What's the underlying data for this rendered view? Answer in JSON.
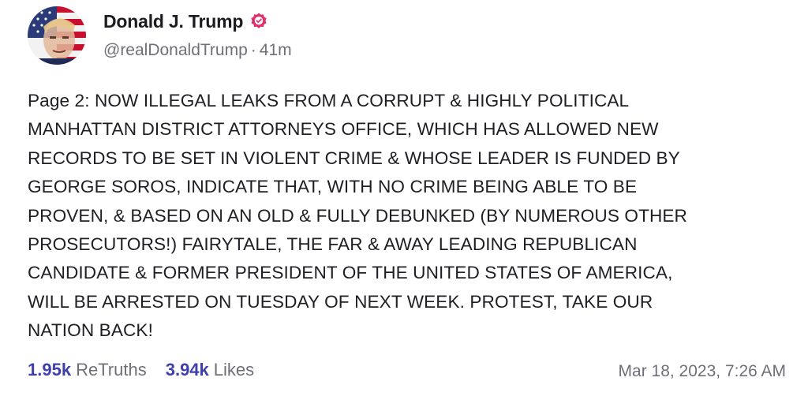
{
  "author": {
    "display_name": "Donald J. Trump",
    "handle": "@realDonaldTrump",
    "separator": "·",
    "time_ago": "41m",
    "avatar_icon": "profile-avatar",
    "verified_icon": "verified-badge-icon",
    "verified_color": "#e0306c"
  },
  "post": {
    "lines": [
      "Page 2: NOW ILLEGAL LEAKS FROM A CORRUPT & HIGHLY POLITICAL",
      "MANHATTAN DISTRICT ATTORNEYS OFFICE, WHICH HAS ALLOWED NEW",
      "RECORDS TO BE SET IN VIOLENT CRIME & WHOSE LEADER IS FUNDED BY",
      "GEORGE SOROS, INDICATE THAT, WITH NO CRIME BEING ABLE TO BE",
      "PROVEN, & BASED ON AN OLD & FULLY DEBUNKED (BY NUMEROUS OTHER",
      "PROSECUTORS!) FAIRYTALE, THE FAR & AWAY LEADING REPUBLICAN",
      "CANDIDATE & FORMER PRESIDENT OF THE UNITED STATES OF AMERICA,",
      "WILL BE ARRESTED ON TUESDAY OF NEXT WEEK. PROTEST, TAKE OUR",
      "NATION BACK!"
    ]
  },
  "stats": {
    "retruths_count": "1.95k",
    "retruths_label": "ReTruths",
    "likes_count": "3.94k",
    "likes_label": "Likes",
    "accent_color": "#3f3fae"
  },
  "timestamp": "Mar 18, 2023, 7:26 AM"
}
